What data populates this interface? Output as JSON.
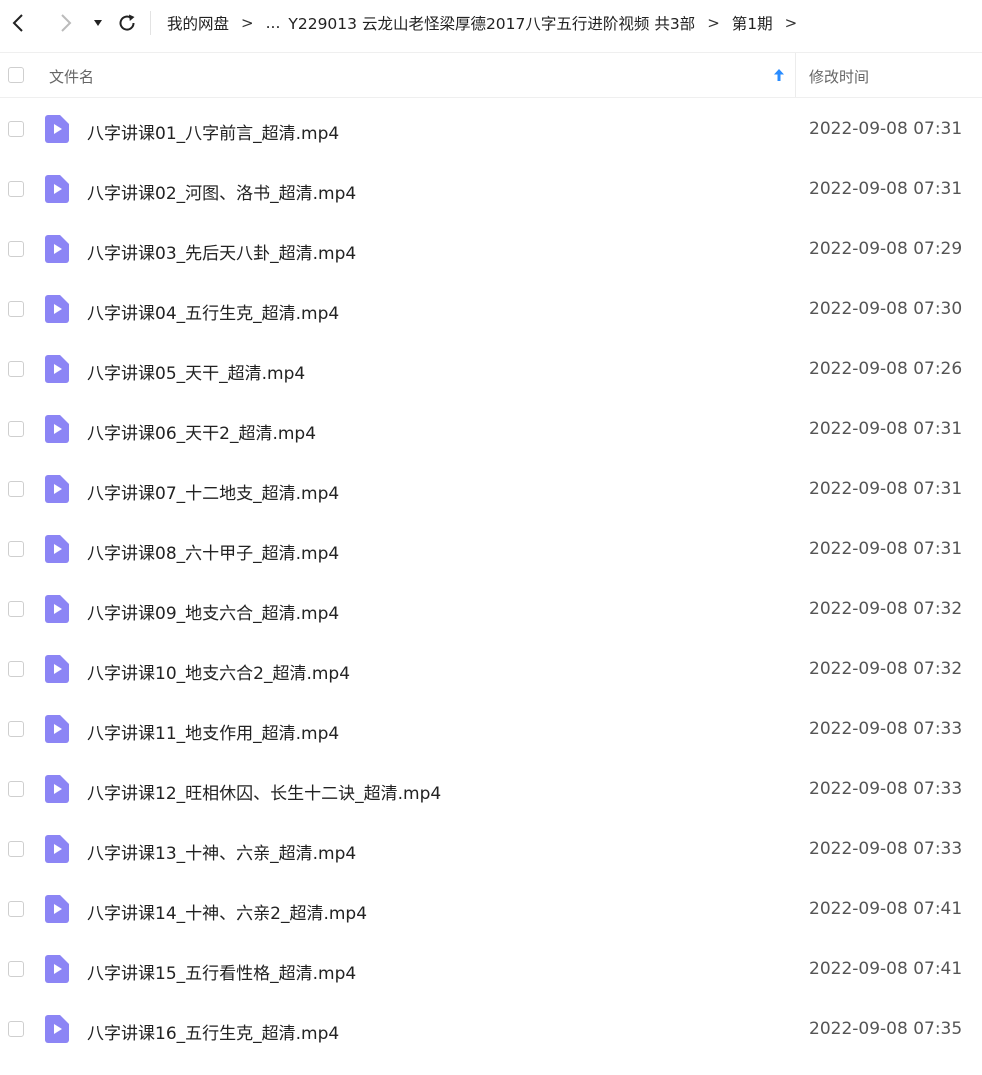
{
  "breadcrumb": {
    "items": [
      "我的网盘",
      "...",
      "Y229013 云龙山老怪梁厚德2017八字五行进阶视频 共3部",
      "第1期"
    ],
    "separator": ">"
  },
  "table": {
    "headers": {
      "name": "文件名",
      "modified": "修改时间"
    },
    "sort": "ascending"
  },
  "files": [
    {
      "name": "八字讲课01_八字前言_超清.mp4",
      "modified": "2022-09-08 07:31"
    },
    {
      "name": "八字讲课02_河图、洛书_超清.mp4",
      "modified": "2022-09-08 07:31"
    },
    {
      "name": "八字讲课03_先后天八卦_超清.mp4",
      "modified": "2022-09-08 07:29"
    },
    {
      "name": "八字讲课04_五行生克_超清.mp4",
      "modified": "2022-09-08 07:30"
    },
    {
      "name": "八字讲课05_天干_超清.mp4",
      "modified": "2022-09-08 07:26"
    },
    {
      "name": "八字讲课06_天干2_超清.mp4",
      "modified": "2022-09-08 07:31"
    },
    {
      "name": "八字讲课07_十二地支_超清.mp4",
      "modified": "2022-09-08 07:31"
    },
    {
      "name": "八字讲课08_六十甲子_超清.mp4",
      "modified": "2022-09-08 07:31"
    },
    {
      "name": "八字讲课09_地支六合_超清.mp4",
      "modified": "2022-09-08 07:32"
    },
    {
      "name": "八字讲课10_地支六合2_超清.mp4",
      "modified": "2022-09-08 07:32"
    },
    {
      "name": "八字讲课11_地支作用_超清.mp4",
      "modified": "2022-09-08 07:33"
    },
    {
      "name": "八字讲课12_旺相休囚、长生十二诀_超清.mp4",
      "modified": "2022-09-08 07:33"
    },
    {
      "name": "八字讲课13_十神、六亲_超清.mp4",
      "modified": "2022-09-08 07:33"
    },
    {
      "name": "八字讲课14_十神、六亲2_超清.mp4",
      "modified": "2022-09-08 07:41"
    },
    {
      "name": "八字讲课15_五行看性格_超清.mp4",
      "modified": "2022-09-08 07:41"
    },
    {
      "name": "八字讲课16_五行生克_超清.mp4",
      "modified": "2022-09-08 07:35"
    }
  ],
  "icons": {
    "back": "chevron-left-icon",
    "forward": "chevron-right-icon",
    "history": "caret-down-icon",
    "refresh": "refresh-icon",
    "sort": "arrow-up-icon",
    "file": "video-file-icon"
  },
  "colors": {
    "file_icon": "#8c85f5",
    "sort_arrow": "#2a8cff",
    "text": "#222222",
    "muted": "#666666"
  }
}
